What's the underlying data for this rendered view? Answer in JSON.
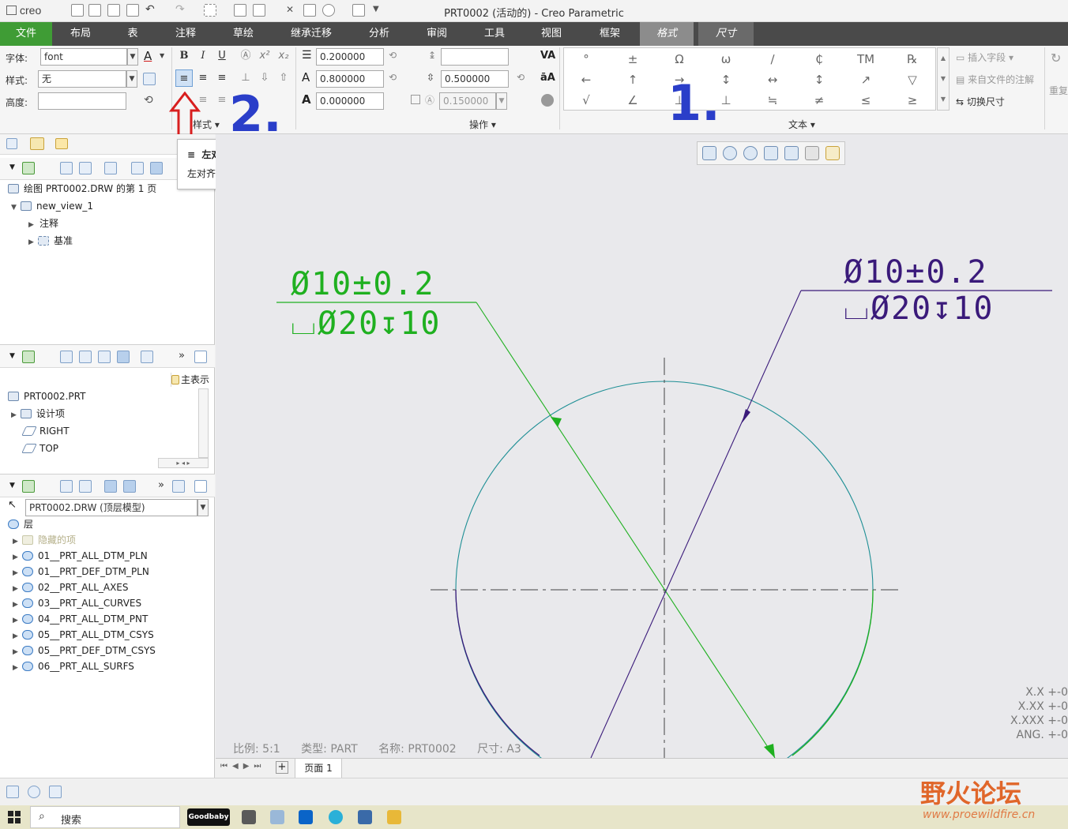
{
  "app": {
    "logo": "creo",
    "window_title": "PRT0002 (活动的) - Creo Parametric"
  },
  "menu": {
    "items": [
      "文件",
      "布局",
      "表",
      "注释",
      "草绘",
      "继承迁移",
      "分析",
      "审阅",
      "工具",
      "视图",
      "框架"
    ],
    "context_tabs": [
      "格式",
      "尺寸"
    ]
  },
  "ribbon": {
    "font_label": "字体:",
    "font_value": "font",
    "style_label": "样式:",
    "style_value": "无",
    "height_label": "高度:",
    "style_group_label": "样式",
    "slant_value": "0.200000",
    "width_factor_value": "0.800000",
    "thickness_value": "0.000000",
    "line_spacing_value": "0.500000",
    "margin_value": "0.150000",
    "ops_label": "操作",
    "text_group_label": "文本",
    "symbols": [
      "°",
      "±",
      "Ω",
      "ω",
      "∕",
      "₵",
      "TM",
      "℞",
      "←",
      "↑",
      "→",
      "↕",
      "↔",
      "↕",
      "↗",
      "▽",
      "√",
      "∠",
      "⊥",
      "⊥",
      "≒",
      "≠",
      "≤",
      "≥"
    ],
    "insert_field": "插入字段",
    "from_file_note": "来自文件的注解",
    "toggle_dimension": "切换尺寸",
    "reset_label": "重复"
  },
  "tooltip": {
    "title": "左对齐",
    "desc": "左对齐文本。"
  },
  "annotations": {
    "num1": "1.",
    "num2": "2."
  },
  "drawing_tree": {
    "root": "绘图 PRT0002.DRW 的第 1 页",
    "view": "new_view_1",
    "children": [
      "注释",
      "基准"
    ]
  },
  "model_tree": {
    "main_label": "主表示",
    "root": "PRT0002.PRT",
    "items": [
      "设计项",
      "RIGHT",
      "TOP"
    ]
  },
  "layer_tree": {
    "selector": "PRT0002.DRW (顶层模型)",
    "header": "层",
    "hidden": "隐藏的项",
    "items": [
      "01__PRT_ALL_DTM_PLN",
      "01__PRT_DEF_DTM_PLN",
      "02__PRT_ALL_AXES",
      "03__PRT_ALL_CURVES",
      "04__PRT_ALL_DTM_PNT",
      "05__PRT_ALL_DTM_CSYS",
      "05__PRT_DEF_DTM_CSYS",
      "06__PRT_ALL_SURFS"
    ]
  },
  "drawing": {
    "note_green_line1": "Ø10±0.2",
    "note_green_line2": "⌴Ø20↧10",
    "note_purple_line1": "Ø10±0.2",
    "note_purple_line2": "⌴Ø20↧10",
    "color_green": "#1fb020",
    "color_purple": "#3a1a7a",
    "color_circle": "#1e8f95"
  },
  "status": {
    "scale": "比例: 5:1",
    "type": "类型: PART",
    "name": "名称: PRT0002",
    "size": "尺寸: A3"
  },
  "tolerance": [
    "X.X  +-0",
    "X.XX  +-0",
    "X.XXX  +-0",
    "ANG.  +-0"
  ],
  "page_bar": {
    "page": "页面 1"
  },
  "taskbar": {
    "search": "搜索",
    "goodbaby": "Goodbaby"
  },
  "watermark_forum": "野火论坛",
  "watermark_url": "www.proewildfire.cn"
}
